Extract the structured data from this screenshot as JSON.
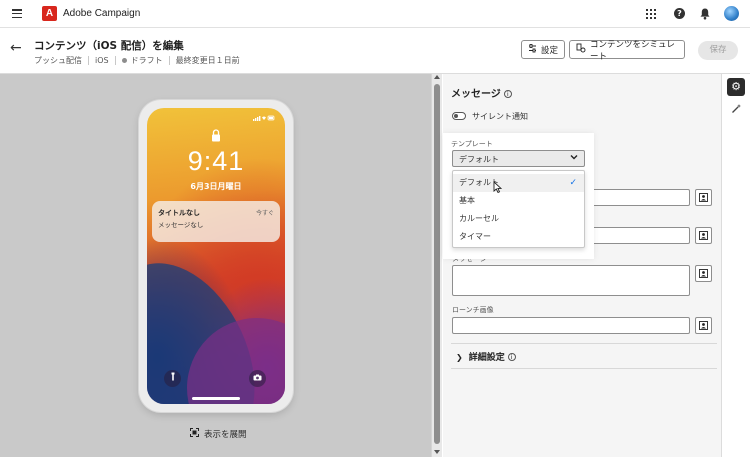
{
  "topbar": {
    "app_name": "Adobe Campaign",
    "logo_letter": "A",
    "icons": [
      "menu-icon",
      "apps-grid-icon",
      "help-icon",
      "notifications-icon",
      "user-avatar"
    ]
  },
  "header": {
    "title": "コンテンツ（iOS 配信）を編集",
    "breadcrumb": [
      "プッシュ配信",
      "iOS",
      "ドラフト",
      "最終変更日１日前"
    ],
    "settings_label": "設定",
    "simulate_label": "コンテンツをシミュレート",
    "save_label": "保存"
  },
  "preview": {
    "time": "9:41",
    "date": "6月3日月曜日",
    "notification": {
      "title": "タイトルなし",
      "body": "メッセージなし",
      "time": "今すぐ"
    },
    "expand_label": "表示を展開"
  },
  "form": {
    "section_title": "メッセージ",
    "silent_label": "サイレント通知",
    "silent_enabled": false,
    "template_label": "テンプレート",
    "template_value": "デフォルト",
    "template_options": [
      "デフォルト",
      "基本",
      "カルーセル",
      "タイマー"
    ],
    "template_selected_index": 0,
    "message_label": "メッセージ",
    "rich_media_label": "ローンチ画像",
    "advanced_label": "詳細設定"
  },
  "colors": {
    "accent": "#1473e6",
    "brand": "#d8271d",
    "panel_bg": "#f5f5f5",
    "preview_bg": "#c9c9c9"
  }
}
